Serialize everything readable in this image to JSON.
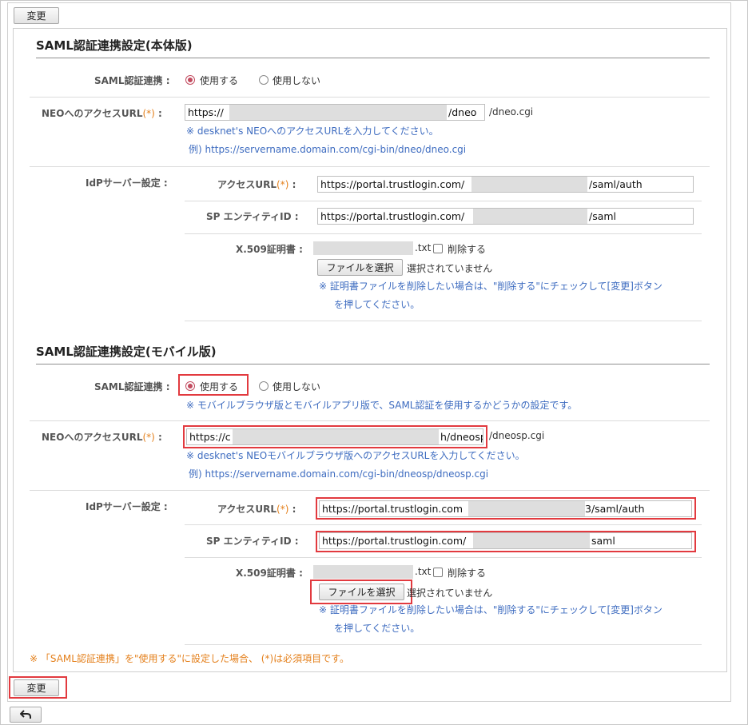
{
  "buttons": {
    "top_change": "変更",
    "bottom_change": "変更",
    "back_icon": "back-arrow-icon"
  },
  "main": {
    "title": "SAML認証連携設定(本体版)",
    "saml_label": "SAML認証連携",
    "use": "使用する",
    "not_use": "使用しない",
    "neo_url_label": "NEOへのアクセスURL",
    "neo_url_value": "https://",
    "neo_url_value_end": "/dneo",
    "neo_url_suffix": "/dneo.cgi",
    "neo_note1": "※ desknet's NEOへのアクセスURLを入力してください。",
    "neo_note2": "例) https://servername.domain.com/cgi-bin/dneo/dneo.cgi",
    "idp_label": "IdPサーバー設定",
    "access_url_label": "アクセスURL",
    "access_url_value": "https://portal.trustlogin.com/",
    "access_url_end": "/saml/auth",
    "sp_label": "SP エンティティID",
    "sp_value": "https://portal.trustlogin.com/",
    "sp_end": "/saml",
    "cert_label": "X.509証明書",
    "cert_file": ".txt",
    "delete_label": "削除する",
    "file_button": "ファイルを選択",
    "no_file": "選択されていません",
    "cert_note1": "※ 証明書ファイルを削除したい場合は、\"削除する\"にチェックして[変更]ボタン",
    "cert_note2": "を押してください。"
  },
  "mobile": {
    "title": "SAML認証連携設定(モバイル版)",
    "saml_label": "SAML認証連携",
    "use": "使用する",
    "not_use": "使用しない",
    "saml_note": "※ モバイルブラウザ版とモバイルアプリ版で、SAML認証を使用するかどうかの設定です。",
    "neo_url_label": "NEOへのアクセスURL",
    "neo_url_value": "https://c",
    "neo_url_value_end": "h/dneosp",
    "neo_url_suffix": "/dneosp.cgi",
    "neo_note1": "※ desknet's NEOモバイルブラウザ版へのアクセスURLを入力してください。",
    "neo_note2": "例) https://servername.domain.com/cgi-bin/dneosp/dneosp.cgi",
    "idp_label": "IdPサーバー設定",
    "access_url_label": "アクセスURL",
    "access_url_value": "https://portal.trustlogin.com",
    "access_url_end": "3/saml/auth",
    "sp_label": "SP エンティティID",
    "sp_value": "https://portal.trustlogin.com/",
    "sp_end": "saml",
    "cert_label": "X.509証明書",
    "cert_file": ".txt",
    "delete_label": "削除する",
    "file_button": "ファイルを選択",
    "no_file": "選択されていません",
    "cert_note1": "※ 証明書ファイルを削除したい場合は、\"削除する\"にチェックして[変更]ボタン",
    "cert_note2": "を押してください。"
  },
  "footer_note": "※ 「SAML認証連携」を\"使用する\"に設定した場合、 (*)は必須項目です。",
  "required_mark": "(*)",
  "colors": {
    "highlight": "#e23a3f",
    "note": "#3e6cc0",
    "required": "#e4801c"
  }
}
